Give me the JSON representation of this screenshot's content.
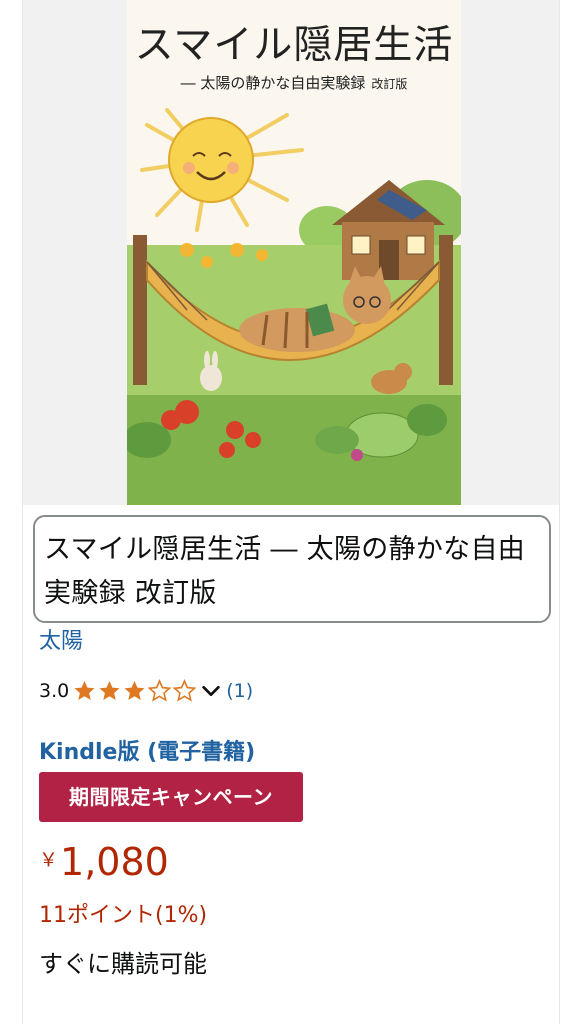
{
  "cover": {
    "title": "スマイル隠居生活",
    "subtitle": "― 太陽の静かな自由実験録",
    "edition": "改訂版"
  },
  "product": {
    "title": "スマイル隠居生活 ― 太陽の静かな自由実験録 改訂版",
    "author": "太陽",
    "rating": "3.0",
    "rating_value": 3.0,
    "rating_max": 5,
    "review_count": "(1)",
    "format": "Kindle版 (電子書籍)",
    "deal_badge": "期間限定キャンペーン",
    "price_symbol": "￥",
    "price_amount": "1,080",
    "points": "11ポイント(1%)",
    "availability": "すぐに購読可能"
  },
  "colors": {
    "link": "#2162a1",
    "price": "#b12704",
    "badge": "#b12245",
    "star": "#de7921",
    "border": "#888c8c"
  },
  "icons": {
    "stars": [
      "star-filled-icon",
      "star-filled-icon",
      "star-filled-icon",
      "star-empty-icon",
      "star-empty-icon"
    ],
    "expand": "chevron-down-icon"
  }
}
